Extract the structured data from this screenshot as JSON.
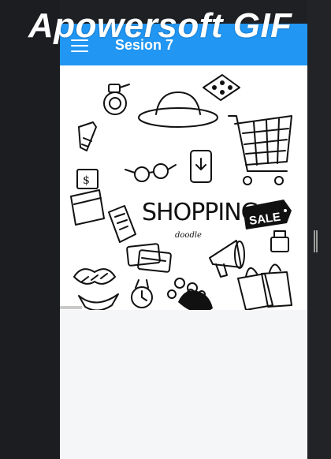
{
  "watermark": {
    "text": "Apowersoft GIF"
  },
  "appbar": {
    "title": "Sesion 7",
    "menu_icon": "menu-icon",
    "color": "#2196f3"
  },
  "image": {
    "headline": "SHOPPING",
    "subtitle": "doodle",
    "sale_tag": "SALE"
  }
}
